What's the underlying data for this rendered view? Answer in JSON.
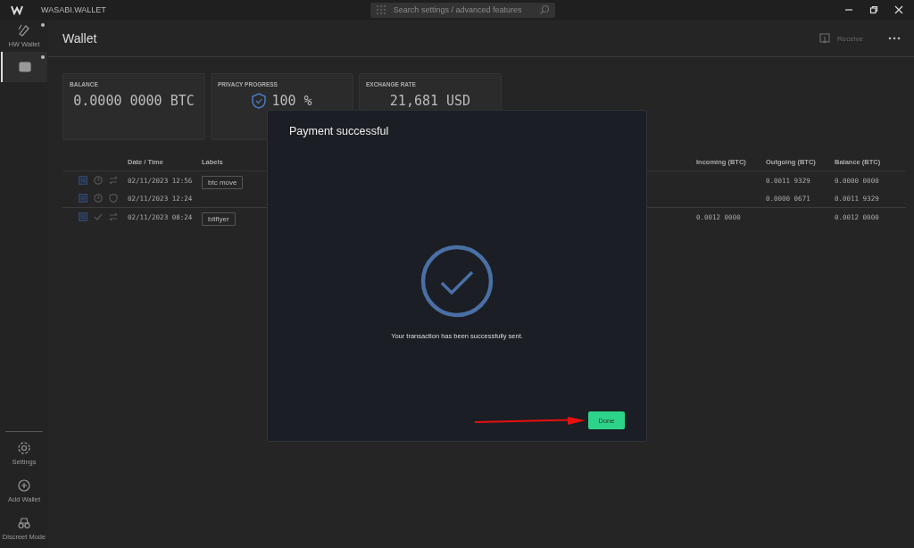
{
  "titlebar": {
    "app_name": "WASABI.WALLET",
    "search": {
      "placeholder": "Search settings / advanced features"
    }
  },
  "sidebar": {
    "items": [
      {
        "kind": "hw",
        "label": "HW Wallet",
        "selected": false
      },
      {
        "kind": "wallet",
        "selected": true
      }
    ],
    "bottom_items": [
      {
        "kind": "settings",
        "label": "Settings"
      },
      {
        "kind": "add",
        "label": "Add Wallet"
      },
      {
        "kind": "discreet",
        "label": "Discreet Mode"
      }
    ]
  },
  "header": {
    "title": "Wallet",
    "receive": "Receive"
  },
  "cards": [
    {
      "kind": "balance",
      "title": "BALANCE",
      "value": "0.0000 0000 BTC"
    },
    {
      "kind": "privacy",
      "title": "PRIVACY PROGRESS",
      "value": "100 %"
    },
    {
      "kind": "rate",
      "title": "EXCHANGE RATE",
      "value": "21,681 USD"
    }
  ],
  "table": {
    "columns": [
      "Date / Time",
      "Labels",
      "Incoming (BTC)",
      "Outgoing (BTC)",
      "Balance (BTC)"
    ],
    "rows": [
      {
        "confirmed": false,
        "coinjoin": false,
        "date": "02/11/2023 12:56",
        "label": "btc move",
        "outgoing": "0.0011 9329",
        "balance": "0.0000 0000"
      },
      {
        "confirmed": false,
        "coinjoin": true,
        "date": "02/11/2023 12:24",
        "outgoing": "0.0000 0671",
        "balance": "0.0011 9329"
      },
      {
        "confirmed": true,
        "coinjoin": false,
        "date": "02/11/2023 08:24",
        "label": "bitflyer",
        "incoming": "0.0012 0000",
        "balance": "0.0012 0000"
      }
    ]
  },
  "dialog": {
    "title": "Payment successful",
    "message": "Your transaction has been successfully sent.",
    "button": "Done"
  }
}
